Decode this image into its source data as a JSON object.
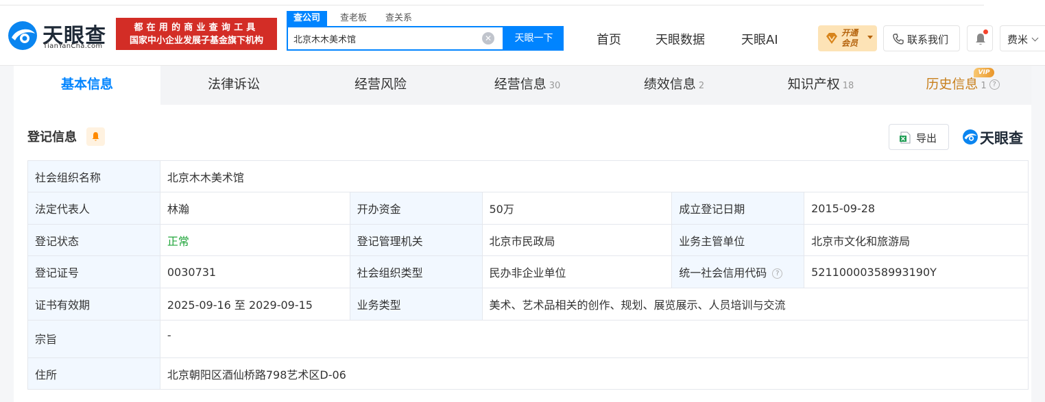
{
  "brand": {
    "name_cn": "天眼查",
    "name_en": "TianYanCha.com",
    "slogan_line1": "都在用的商业查询工具",
    "slogan_line2": "国家中小企业发展子基金旗下机构"
  },
  "search": {
    "tabs": [
      "查公司",
      "查老板",
      "查关系"
    ],
    "value": "北京木木美术馆",
    "button_label": "天眼一下",
    "clear_icon": "close-circle-icon"
  },
  "nav": {
    "items": [
      "首页",
      "天眼数据",
      "天眼AI"
    ],
    "vip_line1": "开通",
    "vip_line2": "会员",
    "contact_label": "联系我们",
    "user_name": "费米"
  },
  "tabs": [
    {
      "label": "基本信息",
      "count": ""
    },
    {
      "label": "法律诉讼",
      "count": ""
    },
    {
      "label": "经营风险",
      "count": ""
    },
    {
      "label": "经营信息",
      "count": "30"
    },
    {
      "label": "绩效信息",
      "count": "2"
    },
    {
      "label": "知识产权",
      "count": "18"
    },
    {
      "label": "历史信息",
      "count": "1"
    }
  ],
  "vip_tag": "VIP",
  "section": {
    "title": "登记信息",
    "export_label": "导出",
    "brand_label": "天眼查"
  },
  "registration": {
    "org_name_label": "社会组织名称",
    "org_name": "北京木木美术馆",
    "legal_rep_label": "法定代表人",
    "legal_rep": "林瀚",
    "capital_label": "开办资金",
    "capital": "50万",
    "reg_date_label": "成立登记日期",
    "reg_date": "2015-09-28",
    "status_label": "登记状态",
    "status": "正常",
    "authority_label": "登记管理机关",
    "authority": "北京市民政局",
    "supervisor_label": "业务主管单位",
    "supervisor": "北京市文化和旅游局",
    "cert_no_label": "登记证号",
    "cert_no": "0030731",
    "org_type_label": "社会组织类型",
    "org_type": "民办非企业单位",
    "credit_code_label": "统一社会信用代码",
    "credit_code": "52110000358993190Y",
    "validity_label": "证书有效期",
    "validity": "2025-09-16 至 2029-09-15",
    "business_type_label": "业务类型",
    "business_type": "美术、艺术品相关的创作、规划、展览展示、人员培训与交流",
    "purpose_label": "宗旨",
    "purpose": "-",
    "address_label": "住所",
    "address": "北京朝阳区酒仙桥路798艺术区D-06"
  },
  "colors": {
    "accent": "#0084ff",
    "slogan_bg": "#d32d26",
    "status_green": "#20a53a",
    "history": "#c87f1b"
  }
}
